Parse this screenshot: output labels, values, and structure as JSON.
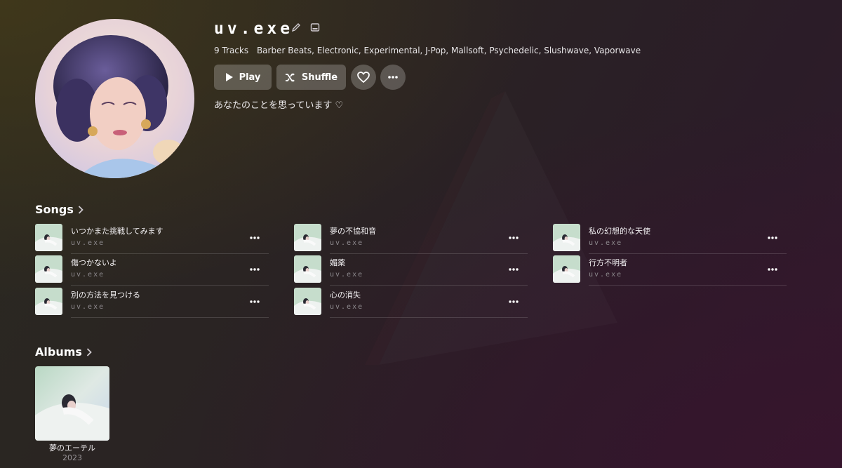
{
  "colors": {
    "button_bg": "rgba(255,255,255,0.22)",
    "text_primary": "#ffffff",
    "text_secondary": "#8e8a8e"
  },
  "artist": {
    "name": "uv.exe",
    "edit_icon": "pencil-icon",
    "image_icon": "image-icon",
    "track_count": "9 Tracks",
    "genres": "Barber Beats, Electronic, Experimental, J-Pop, Mallsoft, Psychedelic, Slushwave, Vaporwave",
    "description": "あなたのことを思っています ♡"
  },
  "actions": {
    "play_label": "Play",
    "shuffle_label": "Shuffle",
    "favorite_icon": "heart-icon",
    "more_icon": "ellipsis-icon"
  },
  "songs": {
    "heading": "Songs",
    "items": [
      {
        "title": "いつかまた挑戦してみます",
        "artist": "uv.exe"
      },
      {
        "title": "傷つかないよ",
        "artist": "uv.exe"
      },
      {
        "title": "別の方法を見つける",
        "artist": "uv.exe"
      },
      {
        "title": "夢の不協和音",
        "artist": "uv.exe"
      },
      {
        "title": "媚薬",
        "artist": "uv.exe"
      },
      {
        "title": "心の消失",
        "artist": "uv.exe"
      },
      {
        "title": "私の幻想的な天使",
        "artist": "uv.exe"
      },
      {
        "title": "行方不明者",
        "artist": "uv.exe"
      }
    ]
  },
  "albums": {
    "heading": "Albums",
    "items": [
      {
        "title": "夢のエーテル",
        "year": "2023"
      }
    ]
  }
}
